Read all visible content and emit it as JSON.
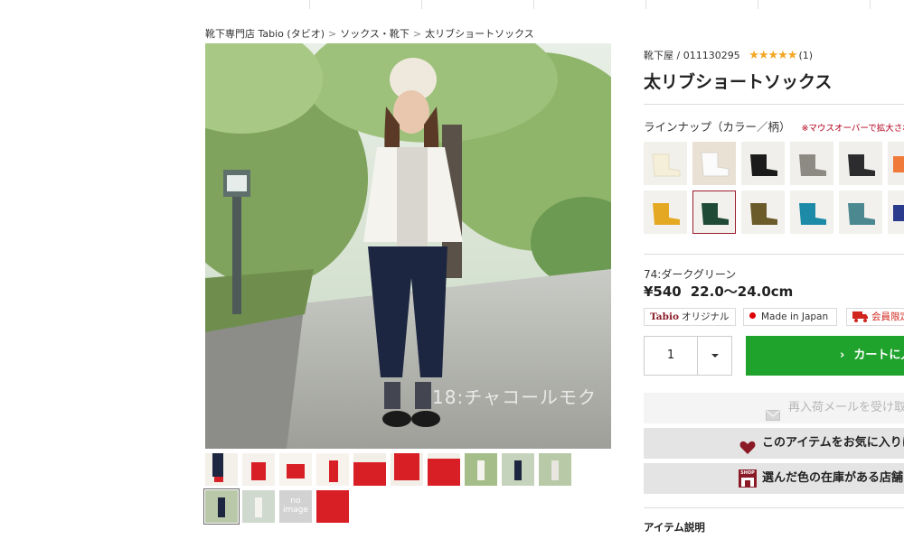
{
  "breadcrumb": {
    "items": [
      "靴下専門店 Tabio (タビオ)",
      "ソックス・靴下",
      "太リブショートソックス"
    ],
    "separator": ">"
  },
  "photo": {
    "caption": "18:チャコールモク"
  },
  "thumbnails": {
    "no_image_line1": "no",
    "no_image_line2": "image"
  },
  "product": {
    "code_line": "靴下屋 / 011130295",
    "stars": "★★★★★",
    "review_count": "(1)",
    "title": "太リブショートソックス"
  },
  "lineup": {
    "label": "ラインナップ（カラー／柄）",
    "note": "※マウスオーバーで拡大され"
  },
  "selection": {
    "color_name": "74:ダークグリーン",
    "price": "¥540",
    "size": "22.0〜24.0cm"
  },
  "badges": {
    "original_logo": "Tabio",
    "original_label": "オリジナル",
    "made_in_japan": "Made in Japan",
    "members_only": "会員限定"
  },
  "purchase": {
    "quantity": "1",
    "cart_label": "カートに入れる"
  },
  "actions": {
    "restock_mail": "再入荷メールを受け取る",
    "favorite": "このアイテムをお気に入りに追加",
    "store_stock": "選んだ色の在庫がある店舗を探す",
    "shop_icon_label": "SHOP"
  },
  "section": {
    "item_description": "アイテム説明"
  },
  "colors": {
    "selected_border": "#9a1b2a",
    "cart_green": "#1fa32c",
    "star": "#f5a623",
    "heart": "#8a1a26"
  }
}
